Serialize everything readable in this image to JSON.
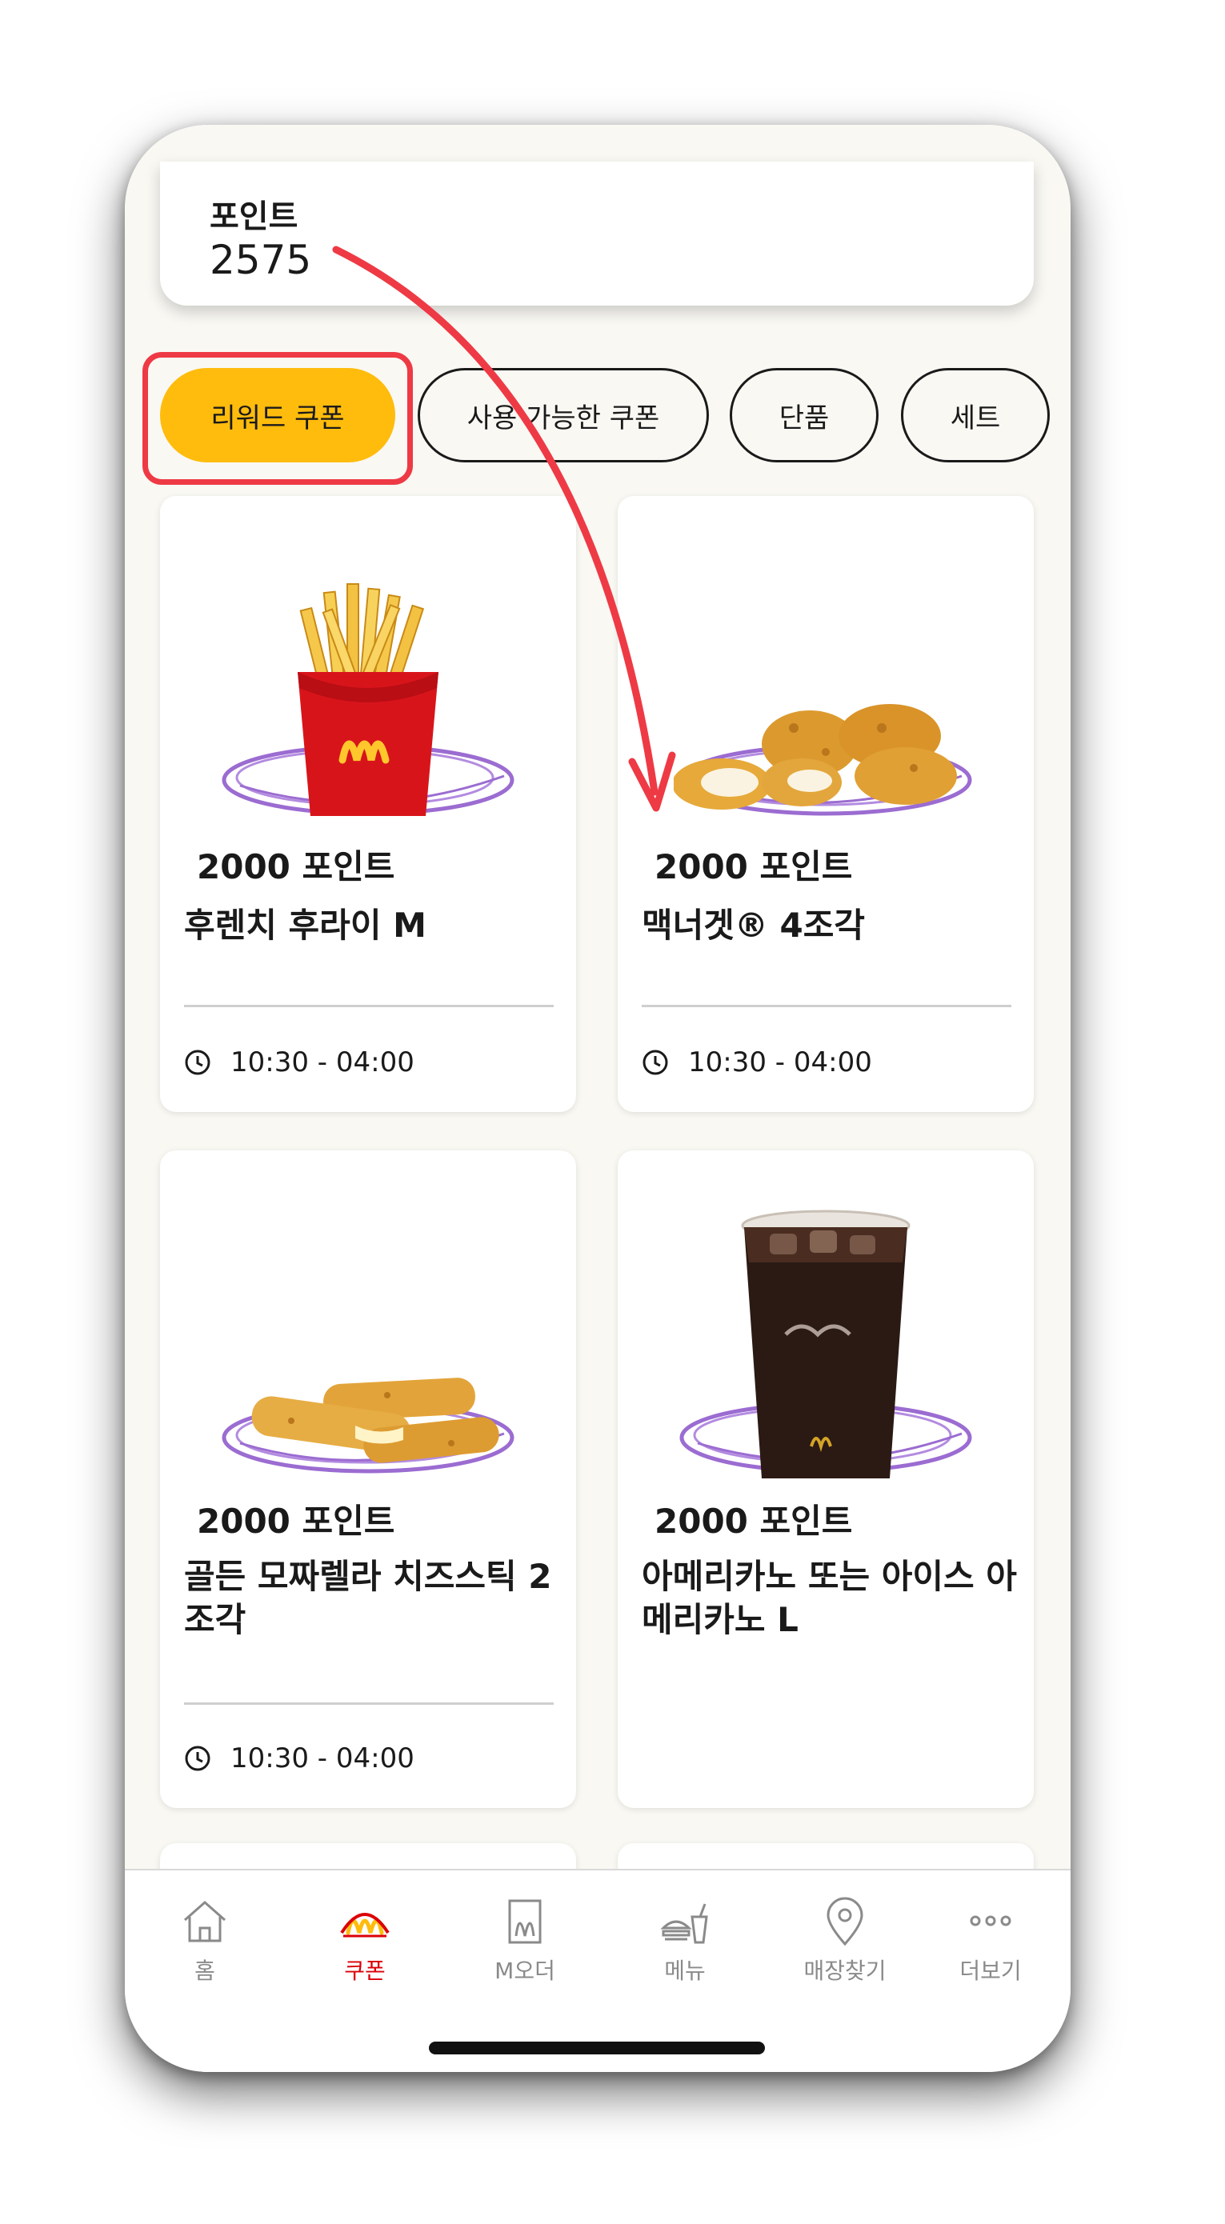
{
  "points": {
    "label": "포인트",
    "value": "2575"
  },
  "filters": [
    {
      "label": "리워드 쿠폰",
      "active": true
    },
    {
      "label": "사용 가능한 쿠폰",
      "active": false
    },
    {
      "label": "단품",
      "active": false
    },
    {
      "label": "세트",
      "active": false
    }
  ],
  "coupons": [
    {
      "points": "2000 포인트",
      "title": "후렌치 후라이 M",
      "time": "10:30 - 04:00",
      "image": "fries-icon"
    },
    {
      "points": "2000 포인트",
      "title": "맥너겟® 4조각",
      "time": "10:30 - 04:00",
      "image": "nuggets-icon"
    },
    {
      "points": "2000 포인트",
      "title": "골든 모짜렐라 치즈스틱 2조각",
      "time": "10:30 - 04:00",
      "image": "cheese-sticks-icon"
    },
    {
      "points": "2000 포인트",
      "title": "아메리카노 또는 아이스 아메리카노 L",
      "time": "",
      "image": "iced-coffee-icon"
    }
  ],
  "nav": [
    {
      "label": "홈",
      "icon": "home-icon",
      "active": false
    },
    {
      "label": "쿠폰",
      "icon": "coupon-arches-icon",
      "active": true
    },
    {
      "label": "M오더",
      "icon": "mobile-order-icon",
      "active": false
    },
    {
      "label": "메뉴",
      "icon": "menu-burger-icon",
      "active": false
    },
    {
      "label": "매장찾기",
      "icon": "location-pin-icon",
      "active": false
    },
    {
      "label": "더보기",
      "icon": "more-dots-icon",
      "active": false
    }
  ],
  "colors": {
    "accent": "#ffbc0d",
    "highlight": "#ee3a45",
    "brand_red": "#db0007",
    "plate_ring": "#9b6cd1"
  }
}
